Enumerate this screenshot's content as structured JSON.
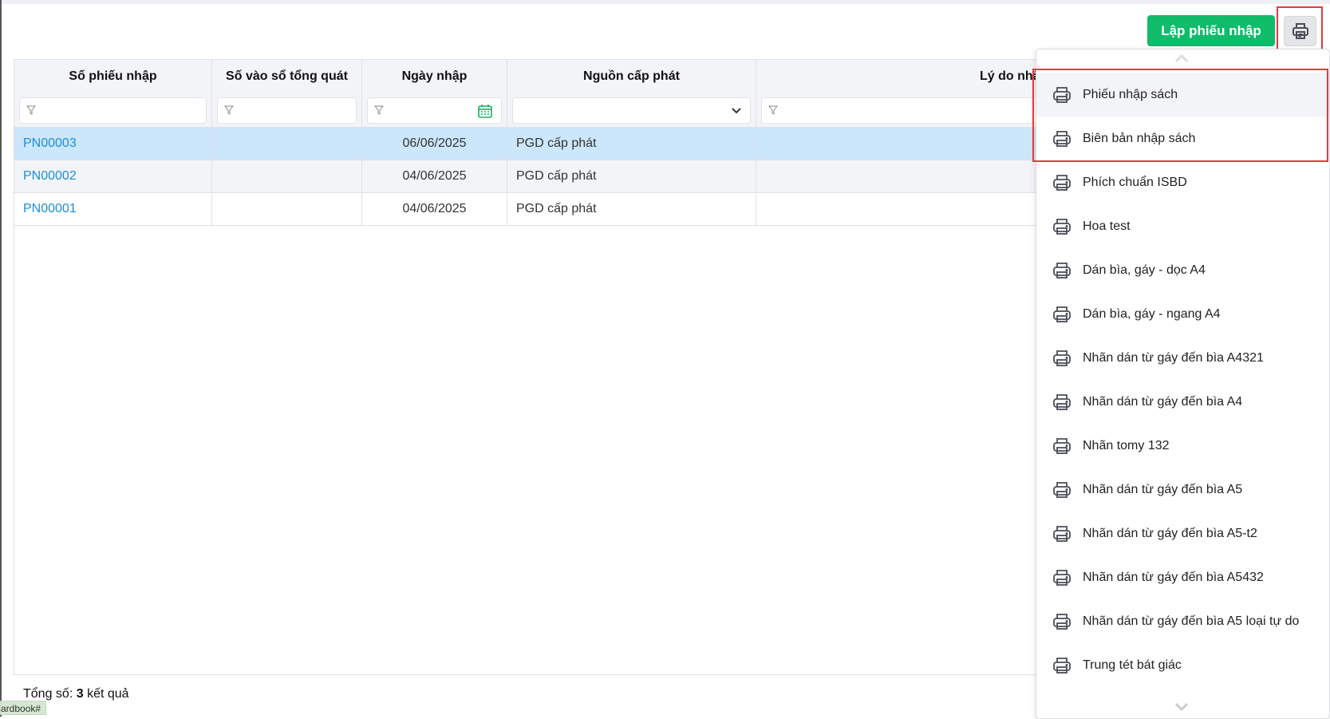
{
  "toolbar": {
    "create_label": "Lập phiếu nhập",
    "print_icon": "printer-icon"
  },
  "table": {
    "columns": [
      "Số phiếu nhập",
      "Số vào sổ tổng quát",
      "Ngày nhập",
      "Nguồn cấp phát",
      "Lý do nhập"
    ],
    "rows": [
      {
        "code": "PN00003",
        "ledger": "",
        "date": "06/06/2025",
        "source": "PGD cấp phát",
        "reason": "",
        "selected": true
      },
      {
        "code": "PN00002",
        "ledger": "",
        "date": "04/06/2025",
        "source": "PGD cấp phát",
        "reason": ""
      },
      {
        "code": "PN00001",
        "ledger": "",
        "date": "04/06/2025",
        "source": "PGD cấp phát",
        "reason": ""
      }
    ]
  },
  "footer": {
    "prefix": "Tổng số:",
    "count": "3",
    "suffix": "kết quả"
  },
  "status_bar": "ardbook#",
  "print_menu": {
    "items": [
      "Phiếu nhập sách",
      "Biên bản nhập sách",
      "Phích chuẩn ISBD",
      "Hoa test",
      "Dán bìa, gáy - dọc A4",
      "Dán bìa, gáy - ngang A4",
      "Nhãn dán từ gáy đến bìa A4321",
      "Nhãn dán từ gáy đến bìa A4",
      "Nhãn tomy 132",
      "Nhãn dán từ gáy đến bìa A5",
      "Nhãn dán từ gáy đến bìa A5-t2",
      "Nhãn dán từ gáy đến bìa A5432",
      "Nhãn dán từ gáy đến bìa A5 loại tự do",
      "Trung tét bát giác"
    ]
  },
  "colors": {
    "accent": "#10bb6a",
    "link": "#1a8ee0",
    "selected_row": "#cce6fb",
    "highlight": "#e5383f"
  }
}
